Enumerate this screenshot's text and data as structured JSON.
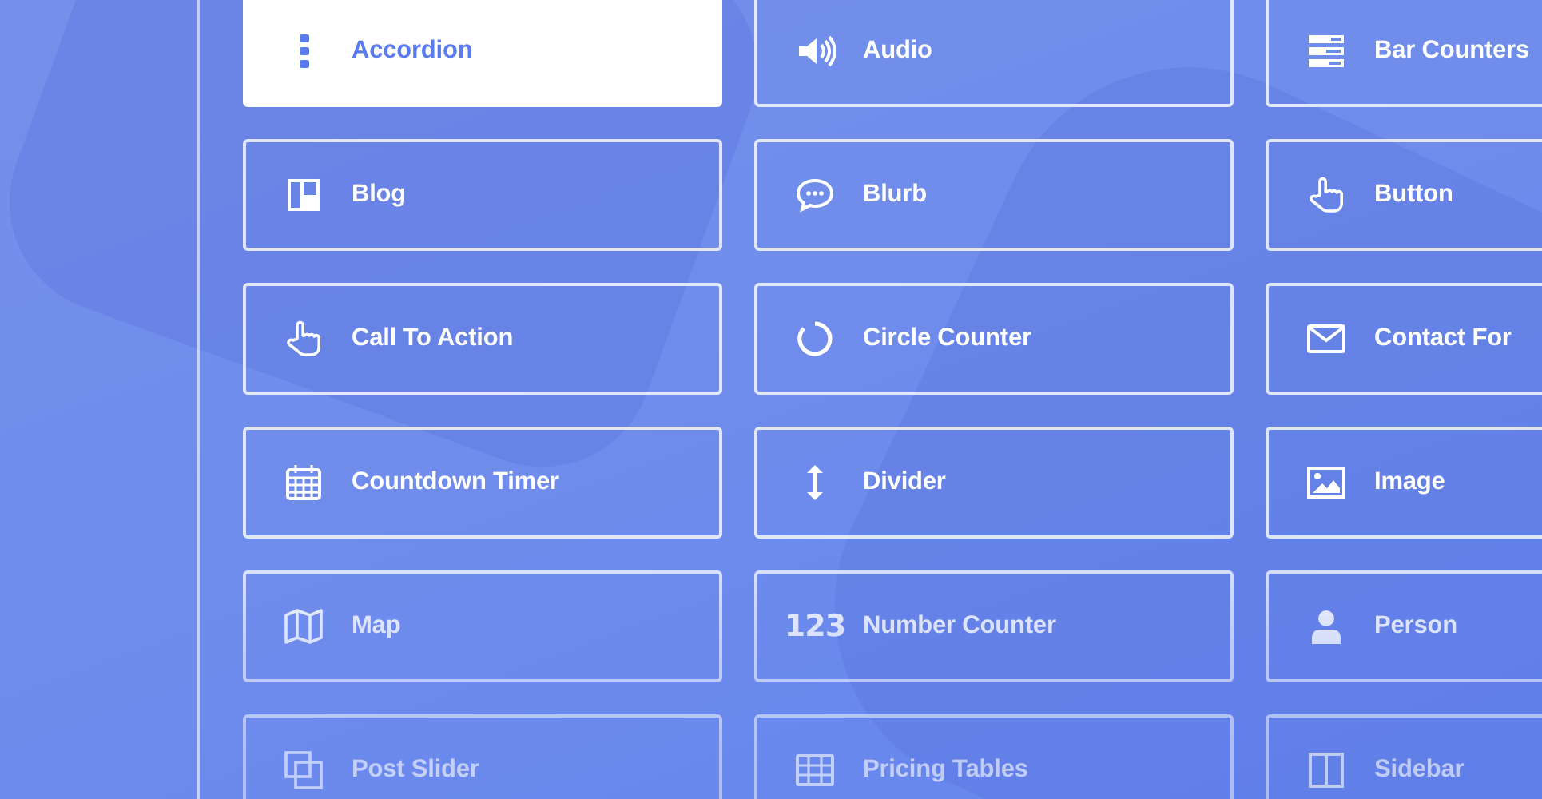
{
  "modules": [
    {
      "label": "Accordion",
      "kind": "dots",
      "selected": true
    },
    {
      "label": "Audio",
      "kind": "speaker",
      "selected": false
    },
    {
      "label": "Bar Counters",
      "kind": "bars",
      "selected": false
    },
    {
      "label": "Blog",
      "kind": "layout",
      "selected": false
    },
    {
      "label": "Blurb",
      "kind": "chat",
      "selected": false
    },
    {
      "label": "Button",
      "kind": "pointer",
      "selected": false
    },
    {
      "label": "Call To Action",
      "kind": "pointer",
      "selected": false
    },
    {
      "label": "Circle Counter",
      "kind": "ring",
      "selected": false
    },
    {
      "label": "Contact For",
      "kind": "envelope",
      "selected": false
    },
    {
      "label": "Countdown Timer",
      "kind": "calendar",
      "selected": false
    },
    {
      "label": "Divider",
      "kind": "updown",
      "selected": false
    },
    {
      "label": "Image",
      "kind": "image",
      "selected": false
    },
    {
      "label": "Map",
      "kind": "map",
      "selected": false
    },
    {
      "label": "Number Counter",
      "kind": "number",
      "icon_text": "123",
      "selected": false
    },
    {
      "label": "Person",
      "kind": "person",
      "selected": false
    },
    {
      "label": "Post Slider",
      "kind": "slides",
      "selected": false
    },
    {
      "label": "Pricing Tables",
      "kind": "table",
      "selected": false
    },
    {
      "label": "Sidebar",
      "kind": "sidebar",
      "selected": false
    }
  ]
}
